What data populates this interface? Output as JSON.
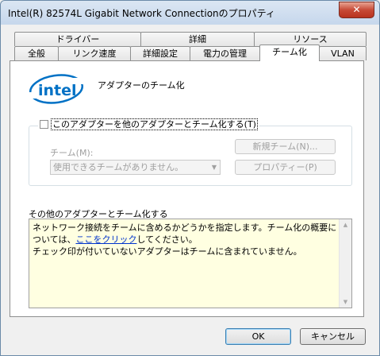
{
  "window": {
    "title": "Intel(R) 82574L Gigabit Network Connectionのプロパティ",
    "close_glyph": "✕"
  },
  "tabs": {
    "row1": [
      "ドライバー",
      "詳細",
      "リソース"
    ],
    "row2": [
      "全般",
      "リンク速度",
      "詳細設定",
      "電力の管理",
      "チーム化",
      "VLAN"
    ],
    "active": "チーム化"
  },
  "panel": {
    "logo_text": "intel",
    "heading": "アダプターのチーム化",
    "team_checkbox_label": "このアダプターを他のアダプターとチーム化する(T)",
    "team_checkbox_checked": false,
    "team_label": "チーム(M):",
    "team_select_value": "使用できるチームがありません。",
    "new_team_button": "新規チーム(N)...",
    "properties_button": "プロパティー(P)",
    "description_title": "その他のアダプターとチーム化する",
    "description_line1": "ネットワーク接続をチームに含めるかどうかを指定します。チーム化の概要については、",
    "description_link": "ここをクリック",
    "description_line1_end": "してください。",
    "description_line2": "チェック印が付いていないアダプターはチームに含まれていません。"
  },
  "footer": {
    "ok_label": "OK",
    "cancel_label": "キャンセル"
  },
  "colors": {
    "intel_blue": "#0071c5",
    "tooltip_yellow": "#ffffe1"
  }
}
